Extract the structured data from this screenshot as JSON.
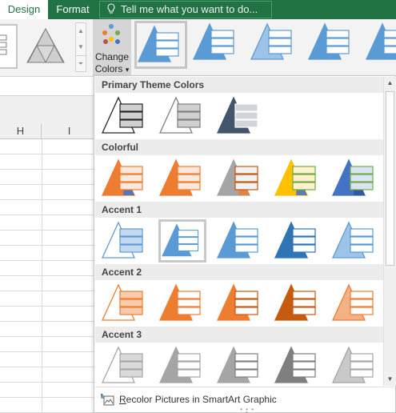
{
  "tabs": [
    {
      "label": "Design",
      "active": true
    },
    {
      "label": "Format",
      "active": false
    }
  ],
  "tell_me": {
    "placeholder": "Tell me what you want to do..."
  },
  "ribbon": {
    "change_colors": {
      "line1": "Change",
      "line2": "Colors",
      "caret": "▾"
    }
  },
  "sheet": {
    "columns": [
      "H",
      "I"
    ]
  },
  "panel": {
    "sections": [
      {
        "title": "Primary Theme Colors",
        "options": [
          {
            "style": "outline",
            "fill": "#ffffff",
            "line": "#262626",
            "box": "#d0d0d0",
            "boxLine": "#262626"
          },
          {
            "style": "outline",
            "fill": "#ffffff",
            "line": "#7f7f7f",
            "box": "#d0d0d0",
            "boxLine": "#7f7f7f"
          },
          {
            "style": "solid",
            "fill": "#44546a",
            "line": "#44546a",
            "box": "#cfd5db",
            "boxLine": "#ffffff"
          }
        ]
      },
      {
        "title": "Colorful",
        "options": [
          {
            "style": "solid",
            "fill": "#ed7d31",
            "line": "#ed7d31",
            "box": "#fde9dc",
            "boxLine": "#ed7d31",
            "accent": "#4472c4"
          },
          {
            "style": "solid",
            "fill": "#ed7d31",
            "line": "#ed7d31",
            "box": "#fde9dc",
            "boxLine": "#ed7d31"
          },
          {
            "style": "solid",
            "fill": "#a5a5a5",
            "line": "#a5a5a5",
            "box": "#f2f2f2",
            "boxLine": "#c55a11",
            "accent": "#ed7d31"
          },
          {
            "style": "solid",
            "fill": "#ffc000",
            "line": "#ffc000",
            "box": "#fff2cc",
            "boxLine": "#70ad47",
            "accent": "#4472c4"
          },
          {
            "style": "solid",
            "fill": "#4472c4",
            "line": "#4472c4",
            "box": "#dae3f3",
            "boxLine": "#70ad47",
            "accent": "#2f5597"
          }
        ]
      },
      {
        "title": "Accent 1",
        "options": [
          {
            "style": "outline",
            "fill": "#dae8f7",
            "line": "#5b9bd5",
            "box": "#c5daf0",
            "boxLine": "#5b9bd5"
          },
          {
            "style": "solid",
            "fill": "#5b9bd5",
            "line": "#5b9bd5",
            "box": "#ffffff",
            "boxLine": "#5b9bd5",
            "selected": true
          },
          {
            "style": "solid",
            "fill": "#5b9bd5",
            "line": "#5b9bd5",
            "box": "#ffffff",
            "boxLine": "#5b9bd5"
          },
          {
            "style": "solid",
            "fill": "#2e75b6",
            "line": "#2e75b6",
            "box": "#ffffff",
            "boxLine": "#2e75b6"
          },
          {
            "style": "solid",
            "fill": "#9dc3e6",
            "line": "#5b9bd5",
            "box": "#ffffff",
            "boxLine": "#5b9bd5"
          }
        ]
      },
      {
        "title": "Accent 2",
        "options": [
          {
            "style": "outline",
            "fill": "#fbe4d5",
            "line": "#ed7d31",
            "box": "#f8cbad",
            "boxLine": "#ed7d31"
          },
          {
            "style": "solid",
            "fill": "#ed7d31",
            "line": "#ed7d31",
            "box": "#ffffff",
            "boxLine": "#ed7d31"
          },
          {
            "style": "solid",
            "fill": "#ed7d31",
            "line": "#ed7d31",
            "box": "#ffffff",
            "boxLine": "#c55a11"
          },
          {
            "style": "solid",
            "fill": "#c55a11",
            "line": "#c55a11",
            "box": "#ffffff",
            "boxLine": "#c55a11"
          },
          {
            "style": "solid",
            "fill": "#f4b183",
            "line": "#ed7d31",
            "box": "#ffffff",
            "boxLine": "#ed7d31"
          }
        ]
      },
      {
        "title": "Accent 3",
        "options": [
          {
            "style": "outline",
            "fill": "#ededed",
            "line": "#a5a5a5",
            "box": "#d9d9d9",
            "boxLine": "#a5a5a5"
          },
          {
            "style": "solid",
            "fill": "#a5a5a5",
            "line": "#a5a5a5",
            "box": "#ffffff",
            "boxLine": "#a5a5a5"
          },
          {
            "style": "solid",
            "fill": "#a5a5a5",
            "line": "#a5a5a5",
            "box": "#ffffff",
            "boxLine": "#7f7f7f"
          },
          {
            "style": "solid",
            "fill": "#7f7f7f",
            "line": "#7f7f7f",
            "box": "#ffffff",
            "boxLine": "#7f7f7f"
          },
          {
            "style": "solid",
            "fill": "#c9c9c9",
            "line": "#a5a5a5",
            "box": "#ffffff",
            "boxLine": "#a5a5a5"
          }
        ]
      }
    ],
    "footer_label": "Recolor Pictures in SmartArt Graphic",
    "footer_underline_char": "R"
  },
  "colors": {
    "excel_green": "#217346",
    "accent_blue": "#5b9bd5",
    "selection_border": "#c8c8c8"
  }
}
